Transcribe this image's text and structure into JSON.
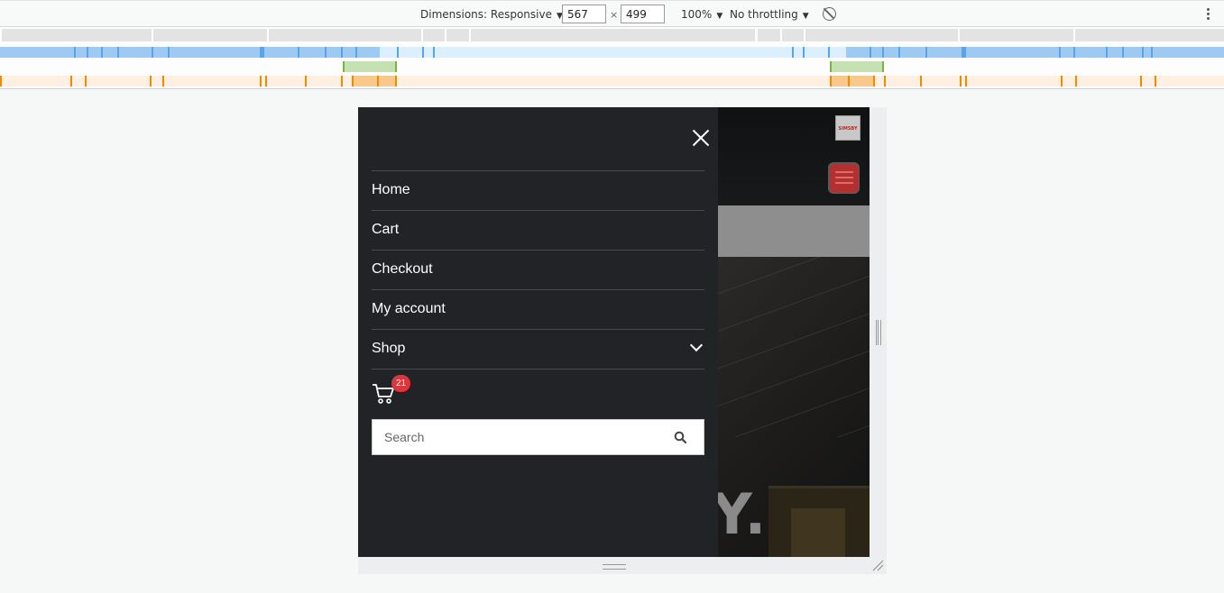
{
  "devtools": {
    "dimensions_label": "Dimensions: Responsive",
    "width_value": "567",
    "height_value": "499",
    "times_sign": "×",
    "zoom": "100%",
    "throttling": "No throttling",
    "rotate_icon": "rotate-icon",
    "more_icon": "kebab-menu-icon"
  },
  "page": {
    "logo_text": "SIMSBY",
    "hero_text": "Y.",
    "menu": {
      "items": [
        {
          "label": "Home"
        },
        {
          "label": "Cart"
        },
        {
          "label": "Checkout"
        },
        {
          "label": "My account"
        },
        {
          "label": "Shop",
          "has_submenu": true
        }
      ],
      "cart_count": "21",
      "search": {
        "placeholder": "Search"
      }
    }
  },
  "colors": {
    "drawer_bg": "#222326",
    "badge": "#d9373d",
    "hamburger": "#b23030",
    "mq_blue": "#9ccaf2",
    "mq_green": "#c5e0b1",
    "mq_orange": "#fde9d0"
  }
}
